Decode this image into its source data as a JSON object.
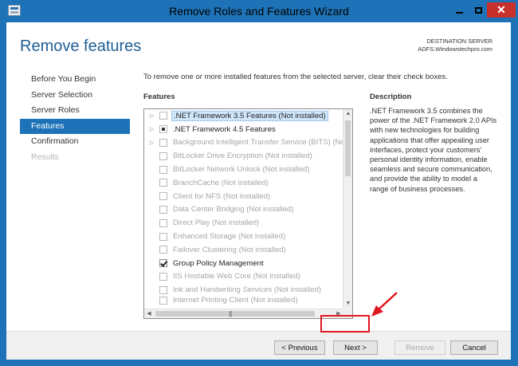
{
  "window": {
    "title": "Remove Roles and Features Wizard",
    "close_glyph": "✕"
  },
  "header": {
    "page_title": "Remove features",
    "destination_label": "DESTINATION SERVER",
    "destination_value": "ADFS.Windowstechpro.com"
  },
  "sidebar": {
    "items": [
      {
        "label": "Before You Begin",
        "state": "normal"
      },
      {
        "label": "Server Selection",
        "state": "normal"
      },
      {
        "label": "Server Roles",
        "state": "normal"
      },
      {
        "label": "Features",
        "state": "active"
      },
      {
        "label": "Confirmation",
        "state": "normal"
      },
      {
        "label": "Results",
        "state": "disabled"
      }
    ]
  },
  "main": {
    "instruction": "To remove one or more installed features from the selected server, clear their check boxes.",
    "features_heading": "Features",
    "description_heading": "Description",
    "description_text": ".NET Framework 3.5 combines the power of the .NET Framework 2.0 APIs with new technologies for building applications that offer appealing user interfaces, protect your customers' personal identity information, enable seamless and secure communication, and provide the ability to model a range of business processes.",
    "features": [
      {
        "label": ".NET Framework 3.5 Features (Not installed)",
        "expandable": true,
        "check": "unchecked",
        "enabled": false,
        "selected": true
      },
      {
        "label": ".NET Framework 4.5 Features",
        "expandable": true,
        "check": "partial",
        "enabled": true,
        "selected": false
      },
      {
        "label": "Background Intelligent Transfer Service (BITS) (Not installed)",
        "expandable": true,
        "check": "unchecked",
        "enabled": false,
        "selected": false
      },
      {
        "label": "BitLocker Drive Encryption (Not installed)",
        "expandable": false,
        "check": "unchecked",
        "enabled": false,
        "selected": false
      },
      {
        "label": "BitLocker Network Unlock (Not installed)",
        "expandable": false,
        "check": "unchecked",
        "enabled": false,
        "selected": false
      },
      {
        "label": "BranchCache (Not installed)",
        "expandable": false,
        "check": "unchecked",
        "enabled": false,
        "selected": false
      },
      {
        "label": "Client for NFS (Not installed)",
        "expandable": false,
        "check": "unchecked",
        "enabled": false,
        "selected": false
      },
      {
        "label": "Data Center Bridging (Not installed)",
        "expandable": false,
        "check": "unchecked",
        "enabled": false,
        "selected": false
      },
      {
        "label": "Direct Play (Not installed)",
        "expandable": false,
        "check": "unchecked",
        "enabled": false,
        "selected": false
      },
      {
        "label": "Enhanced Storage (Not installed)",
        "expandable": false,
        "check": "unchecked",
        "enabled": false,
        "selected": false
      },
      {
        "label": "Failover Clustering (Not installed)",
        "expandable": false,
        "check": "unchecked",
        "enabled": false,
        "selected": false
      },
      {
        "label": "Group Policy Management",
        "expandable": false,
        "check": "checked",
        "enabled": true,
        "selected": false
      },
      {
        "label": "IIS Hostable Web Core (Not installed)",
        "expandable": false,
        "check": "unchecked",
        "enabled": false,
        "selected": false
      },
      {
        "label": "Ink and Handwriting Services (Not installed)",
        "expandable": false,
        "check": "unchecked",
        "enabled": false,
        "selected": false
      },
      {
        "label": "Internet Printing Client (Not installed)",
        "expandable": false,
        "check": "unchecked",
        "enabled": false,
        "selected": false
      }
    ]
  },
  "footer": {
    "previous_label": "< Previous",
    "next_label": "Next >",
    "remove_label": "Remove",
    "cancel_label": "Cancel"
  },
  "annotation": {
    "color": "#e0171f"
  }
}
